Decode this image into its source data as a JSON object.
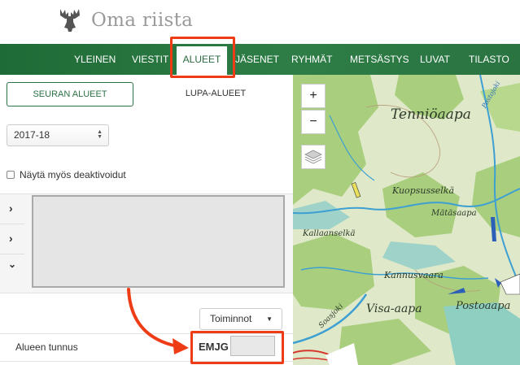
{
  "app": {
    "title": "Oma riista",
    "logo_icon": "moose-icon"
  },
  "nav": {
    "items": [
      {
        "label": "YLEINEN",
        "active": false
      },
      {
        "label": "VIESTIT",
        "active": false
      },
      {
        "label": "ALUEET",
        "active": true
      },
      {
        "label": "JÄSENET",
        "active": false
      },
      {
        "label": "RYHMÄT",
        "active": false
      },
      {
        "label": "METSÄSTYS",
        "active": false
      },
      {
        "label": "LUVAT",
        "active": false
      },
      {
        "label": "TILASTO",
        "active": false
      }
    ]
  },
  "tabs": {
    "seuran_alueet": "SEURAN ALUEET",
    "lupa_alueet": "LUPA-ALUEET"
  },
  "season_select": {
    "value": "2017-18"
  },
  "checkbox": {
    "label": "Näytä myös deaktivoidut",
    "checked": false
  },
  "area_list": {
    "expand_icons": [
      "chevron-right-icon",
      "chevron-right-icon",
      "chevron-down-icon"
    ]
  },
  "actions": {
    "toiminnot_label": "Toiminnot"
  },
  "details": {
    "alueen_tunnus_label": "Alueen tunnus",
    "alueen_tunnus_value": "EMJG"
  },
  "map": {
    "zoom_in": "+",
    "zoom_out": "−",
    "places": [
      "Tenniöaapa",
      "Kuopsusselkä",
      "Mätäsaapa",
      "Kallaanselkä",
      "Kannusvaara",
      "Visa-aapa",
      "Postoaapa",
      "Soasjoki",
      "Postojoki"
    ]
  },
  "colors": {
    "nav_green": "#2a7442",
    "highlight_red": "#ee3c16",
    "map_base": "#dfe9c9",
    "map_forest": "#a9cf7e",
    "map_water": "#3d9fd2"
  }
}
